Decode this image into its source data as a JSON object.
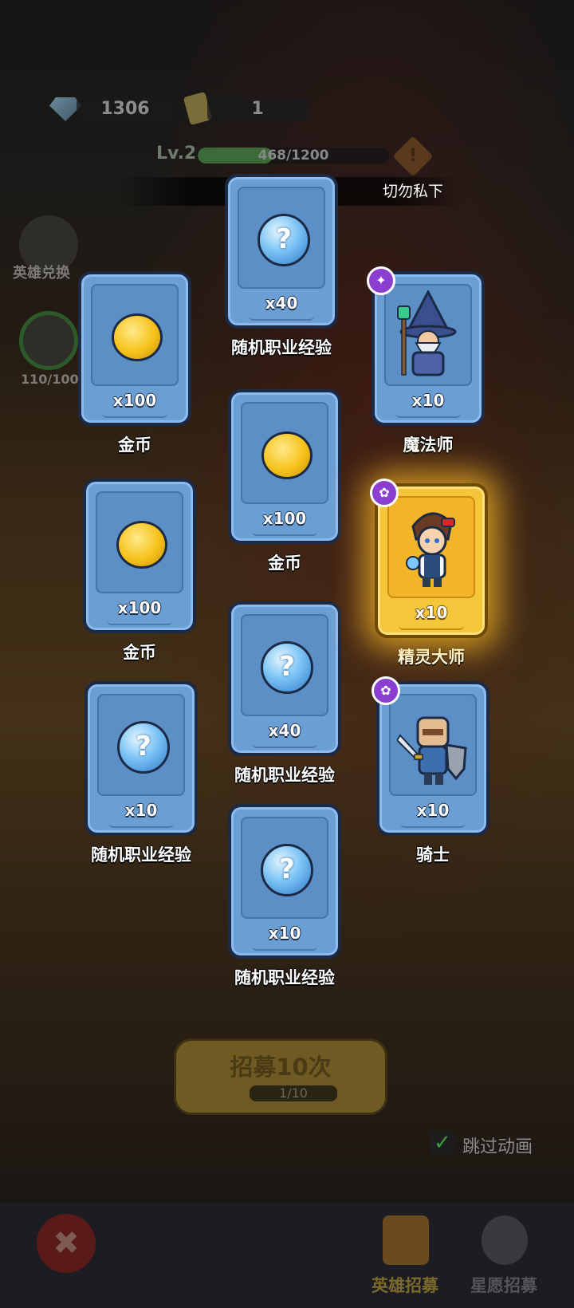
{
  "currency": {
    "gems": "1306",
    "tickets": "1"
  },
  "level": {
    "label": "Lv.2",
    "xp_text": "468/1200",
    "xp_fraction": 0.39
  },
  "notice": "切勿私下",
  "side": {
    "exchange_label": "英雄兑换",
    "counter": "110/100"
  },
  "rewards": {
    "coin1": {
      "qty": "x100",
      "name": "金币"
    },
    "exp1": {
      "qty": "x40",
      "name": "随机职业经验"
    },
    "mage": {
      "qty": "x10",
      "name": "魔法师",
      "badge": "wand-icon"
    },
    "coin2": {
      "qty": "x100",
      "name": "金币"
    },
    "coin3": {
      "qty": "x100",
      "name": "金币"
    },
    "spirit": {
      "qty": "x10",
      "name": "精灵大师",
      "badge": "paw-icon"
    },
    "exp2": {
      "qty": "x40",
      "name": "随机职业经验"
    },
    "exp3": {
      "qty": "x10",
      "name": "随机职业经验"
    },
    "knight": {
      "qty": "x10",
      "name": "骑士",
      "badge": "paw-icon"
    },
    "exp4": {
      "qty": "x10",
      "name": "随机职业经验"
    }
  },
  "recruit": {
    "button_label": "招募10次",
    "progress": "1/10"
  },
  "skip": {
    "label": "跳过动画",
    "checked": true
  },
  "tabs": {
    "hero": "英雄招募",
    "wish": "星愿招募"
  },
  "colors": {
    "card_blue": "#6b9fd4",
    "card_gold": "#f4c63a",
    "exp_green": "#3c6a38"
  }
}
